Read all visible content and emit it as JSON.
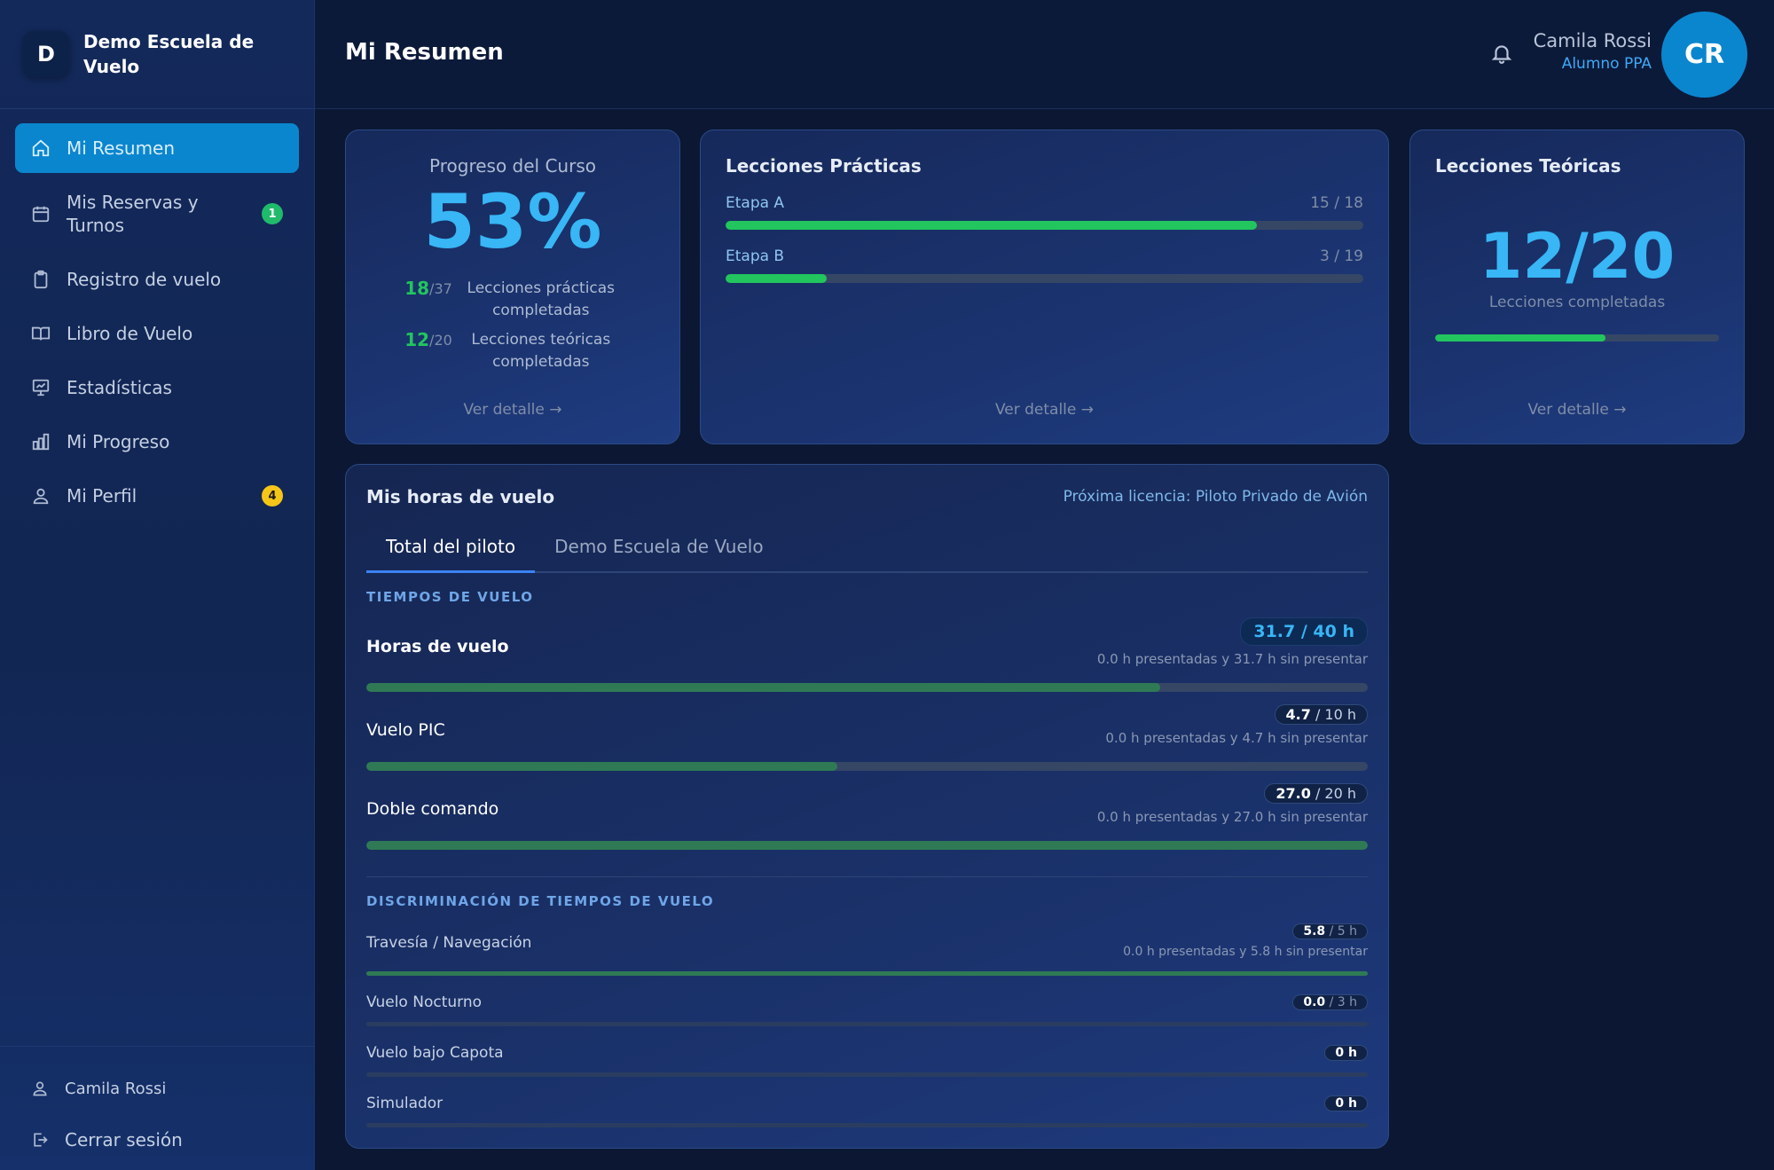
{
  "brand": {
    "logo_letter": "D",
    "name": "Demo Escuela de Vuelo"
  },
  "sidebar": {
    "items": [
      {
        "label": "Mi Resumen",
        "icon": "home-icon",
        "active": true
      },
      {
        "label": "Mis Reservas y Turnos",
        "icon": "calendar-icon",
        "badge": "1",
        "badge_color": "#1fbb6b"
      },
      {
        "label": "Registro de vuelo",
        "icon": "clipboard-icon"
      },
      {
        "label": "Libro de Vuelo",
        "icon": "book-icon"
      },
      {
        "label": "Estadísticas",
        "icon": "presentation-chart-icon"
      },
      {
        "label": "Mi Progreso",
        "icon": "bar-chart-icon"
      },
      {
        "label": "Mi Perfil",
        "icon": "user-icon",
        "badge": "4",
        "badge_color": "#f5c518"
      }
    ],
    "footer": {
      "user": "Camila Rossi",
      "logout": "Cerrar sesión"
    }
  },
  "header": {
    "title": "Mi Resumen",
    "user_name": "Camila Rossi",
    "user_role": "Alumno PPA",
    "avatar_initials": "CR"
  },
  "progress_card": {
    "title": "Progreso del Curso",
    "percent": "53%",
    "practical_done": "18",
    "practical_total": "/37",
    "practical_label": "Lecciones prácticas completadas",
    "theory_done": "12",
    "theory_total": "/20",
    "theory_label": "Lecciones teóricas completadas",
    "link": "Ver detalle →"
  },
  "practicas_card": {
    "title": "Lecciones Prácticas",
    "stages": [
      {
        "name": "Etapa A",
        "count": "15 / 18",
        "fraction": 0.833
      },
      {
        "name": "Etapa B",
        "count": "3 / 19",
        "fraction": 0.158
      }
    ],
    "link": "Ver detalle →"
  },
  "teoricas_card": {
    "title": "Lecciones Teóricas",
    "value": "12/20",
    "subtitle": "Lecciones completadas",
    "fraction": 0.6,
    "link": "Ver detalle →"
  },
  "hours_card": {
    "title": "Mis horas de vuelo",
    "license": "Próxima licencia: Piloto Privado de Avión",
    "tabs": [
      "Total del piloto",
      "Demo Escuela de Vuelo"
    ],
    "section1": "TIEMPOS DE VUELO",
    "main_rows": [
      {
        "name": "Horas de vuelo",
        "value": "31.7 / 40 h",
        "note": "0.0 h presentadas y 31.7 h sin presentar",
        "fraction": 0.7925
      },
      {
        "name": "Vuelo PIC",
        "value": "4.7",
        "total": "/ 10 h",
        "note": "0.0 h presentadas y 4.7 h sin presentar",
        "fraction": 0.47
      },
      {
        "name": "Doble comando",
        "value": "27.0",
        "total": "/ 20 h",
        "note": "0.0 h presentadas y 27.0 h sin presentar",
        "fraction": 1.0
      }
    ],
    "section2": "DISCRIMINACIÓN DE TIEMPOS DE VUELO",
    "detail_rows": [
      {
        "name": "Travesía / Navegación",
        "value": "5.8",
        "total": "/ 5 h",
        "note": "0.0 h presentadas y 5.8 h sin presentar",
        "fraction": 1.0
      },
      {
        "name": "Vuelo Nocturno",
        "value": "0.0",
        "total": "/ 3 h",
        "fraction": 0
      },
      {
        "name": "Vuelo bajo Capota",
        "value": "0 h",
        "fraction": 0
      },
      {
        "name": "Simulador",
        "value": "0 h",
        "fraction": 0
      }
    ]
  }
}
